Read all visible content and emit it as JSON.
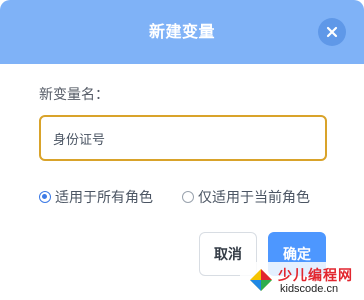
{
  "dialog": {
    "title": "新建变量",
    "close_icon": "close-icon"
  },
  "form": {
    "name_label": "新变量名：",
    "name_value": "身份证号"
  },
  "scope": {
    "options": [
      {
        "label": "适用于所有角色",
        "selected": true
      },
      {
        "label": "仅适用于当前角色",
        "selected": false
      }
    ]
  },
  "buttons": {
    "cancel": "取消",
    "ok": "确定"
  },
  "watermark": {
    "title": "少儿编程网",
    "url": "kidscode.cn",
    "logo_icon": "kidscode-logo-icon"
  },
  "colors": {
    "header": "#7fb2f7",
    "close_button": "#5f98e8",
    "input_focus_border": "#d9a32a",
    "primary_button": "#4d97ff",
    "radio_selected": "#3d7be6",
    "watermark_title": "#e2262f"
  }
}
